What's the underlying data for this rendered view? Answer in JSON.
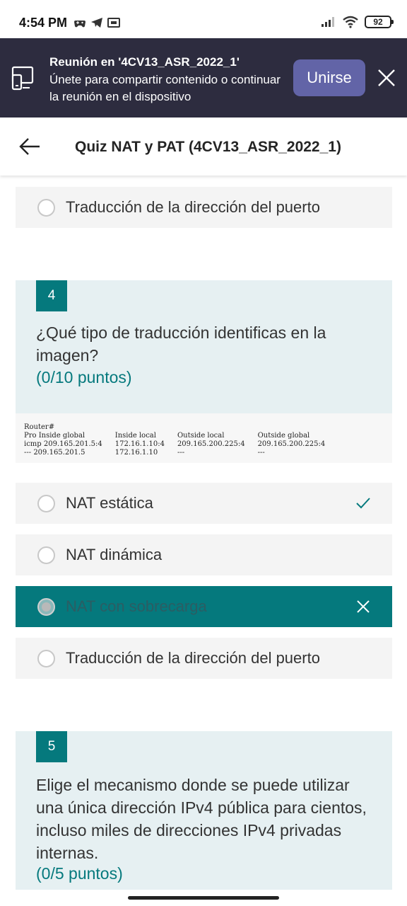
{
  "status_bar": {
    "time": "4:54 PM",
    "battery": "92",
    "left_icons": [
      "gamepad-icon",
      "telegram-icon",
      "vpn-icon"
    ],
    "right_icons": [
      "signal-icon",
      "wifi-icon",
      "battery-icon"
    ]
  },
  "meeting_banner": {
    "title": "Reunión en '4CV13_ASR_2022_1'",
    "text": "Únete para compartir contenido o continuar la reunión en el dispositivo",
    "join_label": "Unirse",
    "colors": {
      "background": "#2d2c3f",
      "button": "#6264a7"
    }
  },
  "header": {
    "title": "Quiz NAT y PAT (4CV13_ASR_2022_1)"
  },
  "previous_question": {
    "last_option": "Traducción de la dirección del puerto"
  },
  "question_4": {
    "number": "4",
    "text": "¿Qué tipo de traducción identificas en la imagen?",
    "points": "(0/10 puntos)",
    "image": {
      "prompt": "Router#",
      "headers": [
        "Pro Inside global",
        "Inside local",
        "Outside local",
        "Outside global"
      ],
      "rows": [
        [
          "icmp 209.165.201.5:4",
          "172.16.1.10:4",
          "209.165.200.225:4",
          "209.165.200.225:4"
        ],
        [
          "--- 209.165.201.5",
          "172.16.1.10",
          "---",
          "---"
        ]
      ]
    },
    "options": [
      {
        "label": "NAT estática",
        "state": "correct"
      },
      {
        "label": "NAT dinámica",
        "state": "none"
      },
      {
        "label": "NAT con sobrecarga",
        "state": "selected-wrong"
      },
      {
        "label": "Traducción de la dirección del puerto",
        "state": "none"
      }
    ]
  },
  "question_5": {
    "number": "5",
    "text": "Elige el mecanismo donde se puede utilizar una única dirección IPv4 pública para cientos, incluso miles de direcciones IPv4 privadas internas.",
    "points": "(0/5 puntos)"
  },
  "colors": {
    "accent": "#05797d",
    "card_bg": "#e6f0f2",
    "option_bg": "#f4f4f4"
  }
}
